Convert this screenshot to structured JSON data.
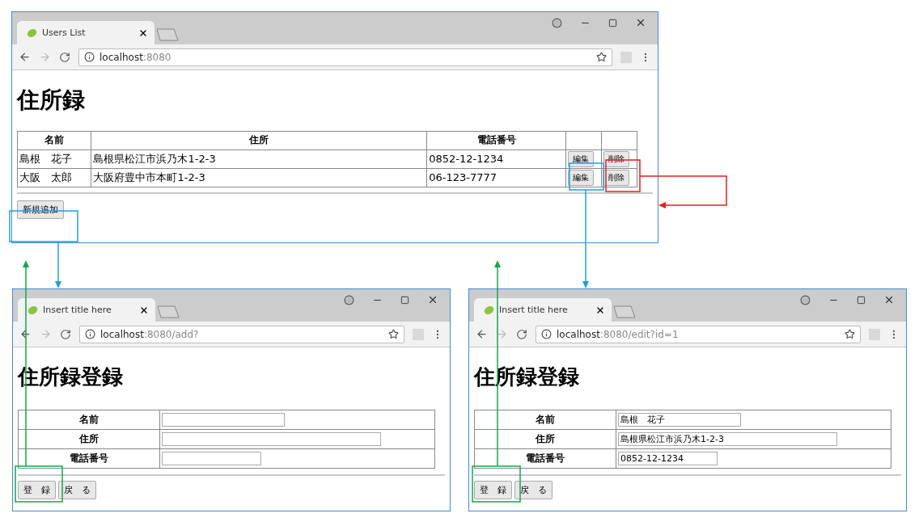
{
  "windows": [
    {
      "kind": "list",
      "tab": {
        "title": "Users List"
      },
      "address": {
        "host": "localhost",
        "rest": ":8080"
      },
      "heading": "住所録",
      "table": {
        "columns": [
          "名前",
          "住所",
          "電話番号"
        ],
        "rows": [
          {
            "cells": [
              "島根　花子",
              "島根県松江市浜乃木1-2-3",
              "0852-12-1234"
            ],
            "actions": [
              "編集",
              "削除"
            ]
          },
          {
            "cells": [
              "大阪　太郎",
              "大阪府豊中市本町1-2-3",
              "06-123-7777"
            ],
            "actions": [
              "編集",
              "削除"
            ]
          }
        ]
      },
      "buttons": [
        "新規追加"
      ]
    },
    {
      "kind": "form",
      "tab": {
        "title": "Insert title here"
      },
      "address": {
        "host": "localhost",
        "rest": ":8080/add?"
      },
      "heading": "住所録登録",
      "fields": [
        {
          "label": "名前"
        },
        {
          "label": "住所"
        },
        {
          "label": "電話番号"
        }
      ],
      "buttons": [
        "登　録",
        "戻　る"
      ]
    },
    {
      "kind": "form",
      "tab": {
        "title": "Insert title here"
      },
      "address": {
        "host": "localhost",
        "rest": ":8080/edit?id=1"
      },
      "heading": "住所録登録",
      "fields": [
        {
          "label": "名前",
          "value": "島根　花子"
        },
        {
          "label": "住所",
          "value": "島根県松江市浜乃木1-2-3"
        },
        {
          "label": "電話番号",
          "value": "0852-12-1234"
        }
      ],
      "buttons": [
        "登　録",
        "戻　る"
      ]
    }
  ]
}
